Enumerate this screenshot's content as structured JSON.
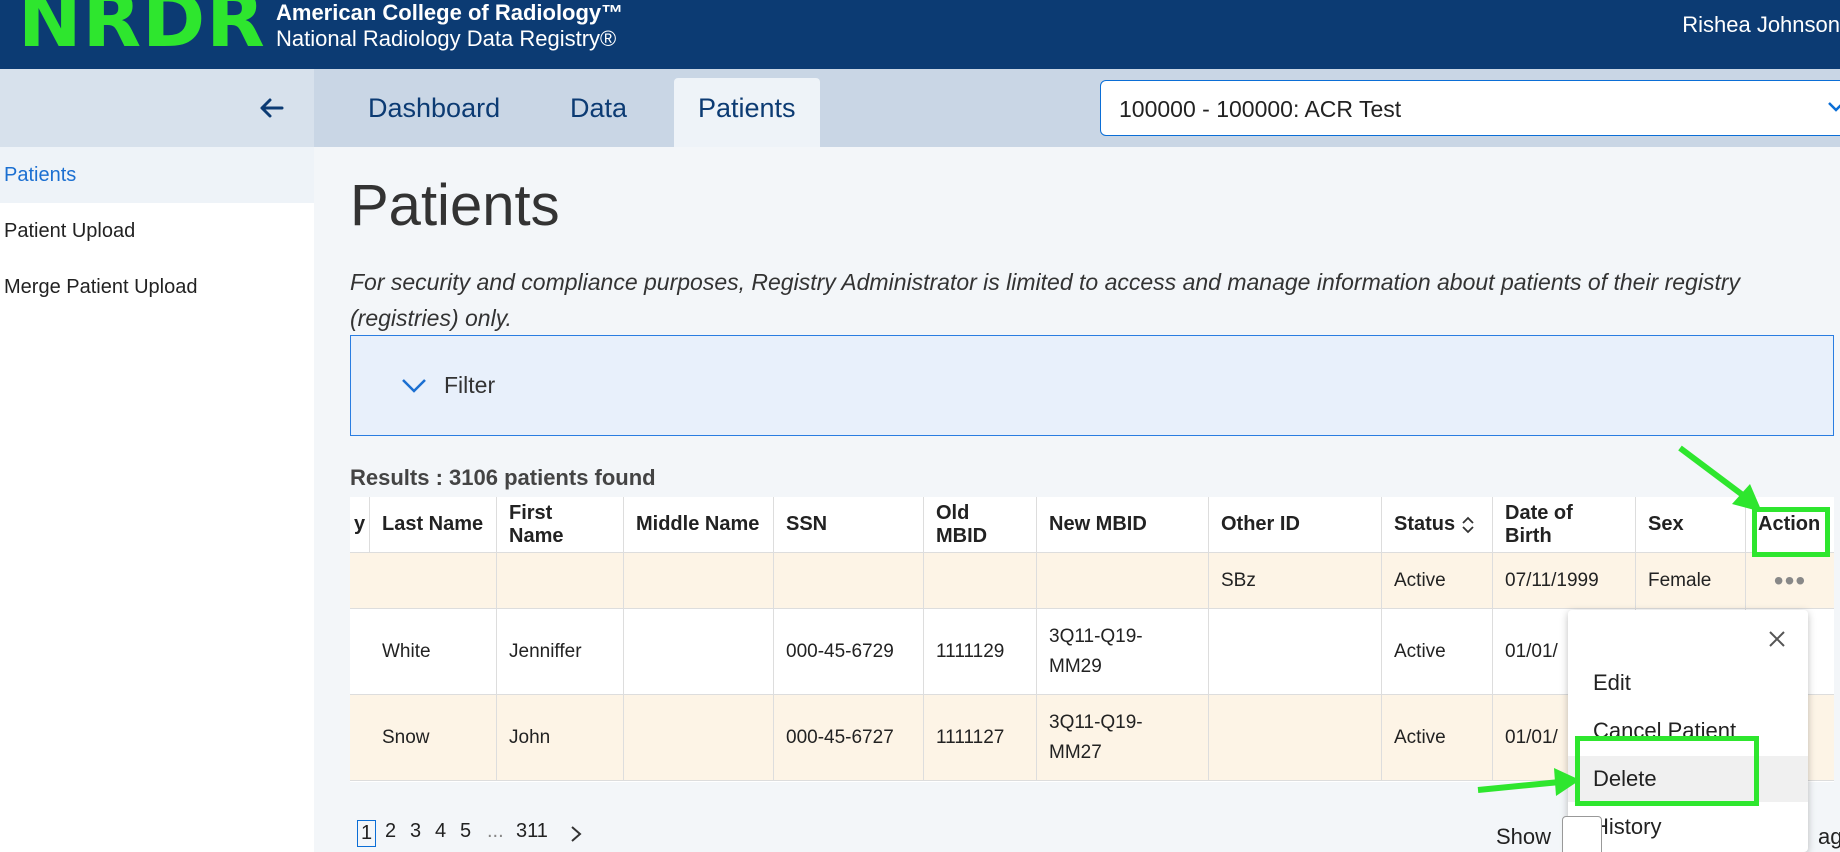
{
  "header": {
    "logo": "NRDR",
    "org_line1": "American College of Radiology™",
    "org_line2": "National Radiology Data Registry®",
    "user_name": "Rishea Johnson"
  },
  "nav": {
    "tabs": [
      {
        "label": "Dashboard"
      },
      {
        "label": "Data"
      },
      {
        "label": "Patients"
      }
    ],
    "facility_select": "100000 - 100000: ACR Test"
  },
  "sidebar": {
    "items": [
      {
        "label": "Patients"
      },
      {
        "label": "Patient Upload"
      },
      {
        "label": "Merge Patient Upload"
      }
    ]
  },
  "main": {
    "title": "Patients",
    "notice": "For security and compliance purposes, Registry Administrator is limited to access and manage information about patients of their registry (registries) only.",
    "filter_label": "Filter",
    "results": "Results : 3106 patients found"
  },
  "table": {
    "columns": [
      "y",
      "Last Name",
      "First Name",
      "Middle Name",
      "SSN",
      "Old MBID",
      "New MBID",
      "Other ID",
      "Status",
      "Date of Birth",
      "Sex",
      "Action"
    ],
    "rows": [
      {
        "last": "",
        "first": "",
        "middle": "",
        "ssn": "",
        "old_mbid": "",
        "new_mbid_1": "",
        "new_mbid_2": "",
        "other_id": "SBz",
        "status": "Active",
        "dob": "07/11/1999",
        "sex": "Female",
        "action": "•••"
      },
      {
        "last": "White",
        "first": "Jenniffer",
        "middle": "",
        "ssn": "000-45-6729",
        "old_mbid": "1111129",
        "new_mbid_1": "3Q11-Q19-",
        "new_mbid_2": "MM29",
        "other_id": "",
        "status": "Active",
        "dob": "01/01/",
        "sex": "",
        "action": ""
      },
      {
        "last": "Snow",
        "first": "John",
        "middle": "",
        "ssn": "000-45-6727",
        "old_mbid": "1111127",
        "new_mbid_1": "3Q11-Q19-",
        "new_mbid_2": "MM27",
        "other_id": "",
        "status": "Active",
        "dob": "01/01/",
        "sex": "",
        "action": ""
      }
    ]
  },
  "menu": {
    "items": [
      "Edit",
      "Cancel Patient",
      "Delete",
      "History"
    ]
  },
  "pagination": {
    "pages": [
      "1",
      "2",
      "3",
      "4",
      "5",
      "...",
      "311"
    ],
    "show_label": "Show",
    "suffix": "age"
  },
  "colors": {
    "header_bg": "#0c3b73",
    "logo": "#2ee62e",
    "accent": "#1b6fd1",
    "highlight": "#2ee62e",
    "row_alt": "#fdf4e6"
  }
}
